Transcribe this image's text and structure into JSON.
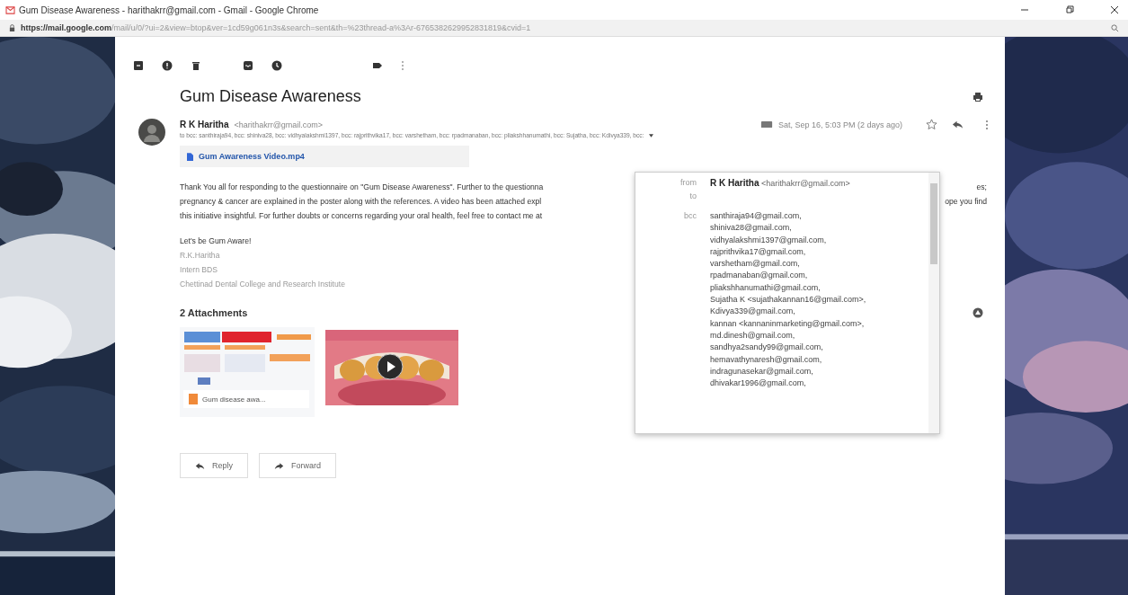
{
  "window": {
    "title": "Gum Disease Awareness - harithakrr@gmail.com - Gmail - Google Chrome"
  },
  "address_bar": {
    "host": "https://mail.google.com",
    "path": "/mail/u/0/?ui=2&view=btop&ver=1cd59g061n3s&search=sent&th=%23thread-a%3Ar-6765382629952831819&cvid=1"
  },
  "email": {
    "subject": "Gum Disease Awareness",
    "sender_name": "R K Haritha",
    "sender_email": "<harithakrr@gmail.com>",
    "recipients": "to bcc: santhiraja94, bcc: shiniva28, bcc: vidhyalakshmi1397, bcc: rajprithvika17, bcc: varshetham, bcc: rpadmanaban, bcc: pliakshhanumathi, bcc: Sujatha, bcc: Kdivya339, bcc:",
    "date": "Sat, Sep 16, 5:03 PM (2 days ago)",
    "attachment_chip": "Gum Awareness Video.mp4",
    "body_lines": [
      {
        "left": "Thank You all for responding to the questionnaire on \"Gum Disease Awareness\". Further to the questionna",
        "right": "es;"
      },
      {
        "left": "pregnancy & cancer are explained in the poster along with the references. A video has been attached expl",
        "right": "ope you find"
      },
      {
        "left": "this initiative insightful. For further doubts or concerns regarding your oral health, feel free to contact me at"
      }
    ],
    "closing": "Let's be Gum Aware!",
    "signature": [
      "R.K.Haritha",
      "Intern BDS",
      "Chettinad Dental College and Research Institute"
    ],
    "attachments_heading": "2 Attachments",
    "attachments": [
      {
        "kind": "document",
        "caption": "Gum disease awa..."
      },
      {
        "kind": "video"
      }
    ],
    "actions": [
      "Reply",
      "Forward"
    ]
  },
  "recipient_popup": {
    "from_label": "from",
    "from_name": "R K Haritha",
    "from_email": "<harithakrr@gmail.com>",
    "to_label": "to",
    "bcc_label": "bcc",
    "bcc": [
      "santhiraja94@gmail.com,",
      "shiniva28@gmail.com,",
      "vidhyalakshmi1397@gmail.com,",
      "rajprithvika17@gmail.com,",
      "varshetham@gmail.com,",
      "rpadmanaban@gmail.com,",
      "pliakshhanumathi@gmail.com,",
      "Sujatha K <sujathakannan16@gmail.com>,",
      "Kdivya339@gmail.com,",
      "kannan <kannaninmarketing@gmail.com>,",
      "md.dinesh@gmail.com,",
      "sandhya2sandy99@gmail.com,",
      "hemavathynaresh@gmail.com,",
      "indragunasekar@gmail.com,",
      "dhivakar1996@gmail.com,"
    ]
  }
}
